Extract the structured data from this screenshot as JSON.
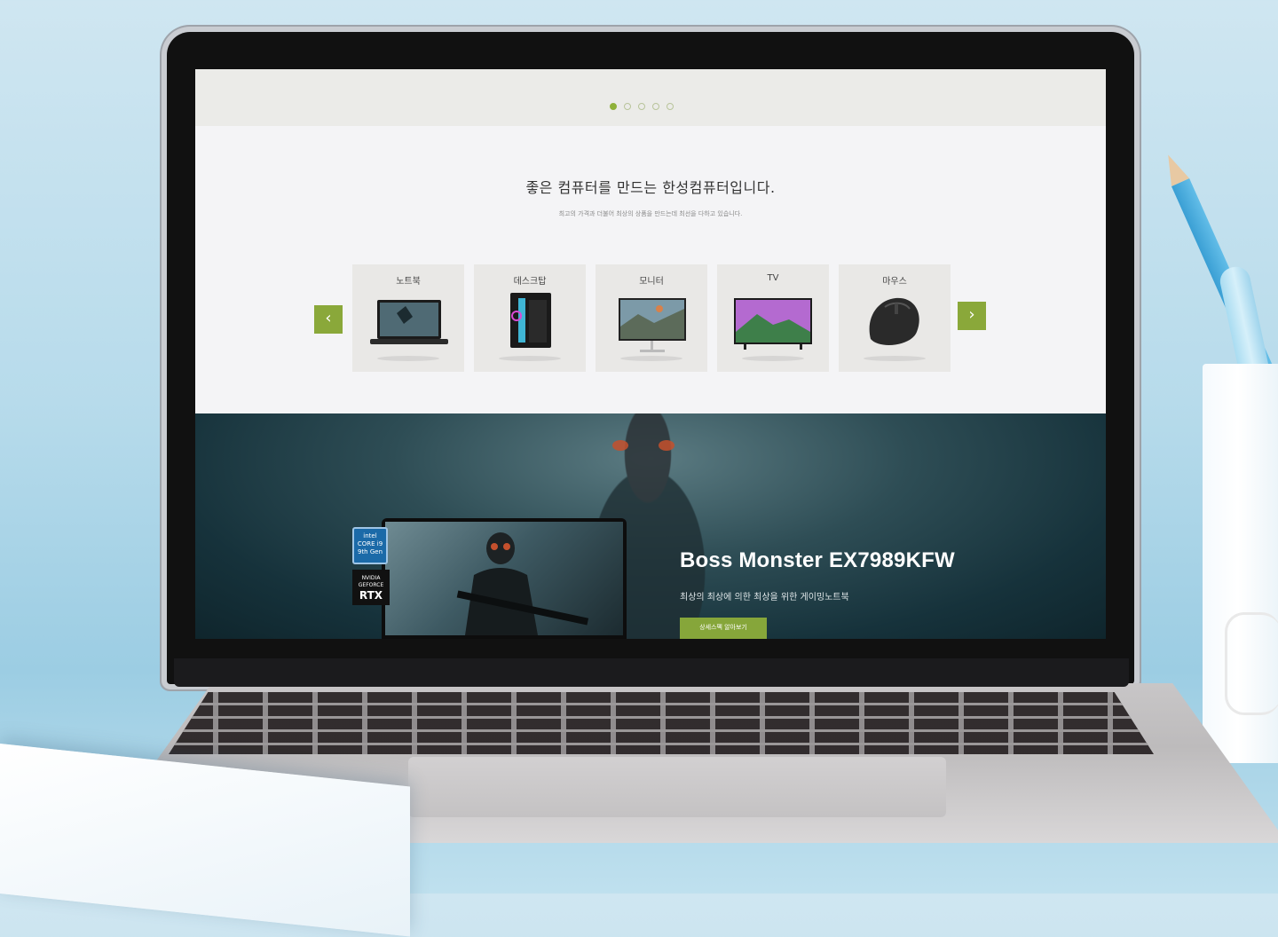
{
  "slider": {
    "dots": 5,
    "active_index": 0
  },
  "intro": {
    "headline": "좋은 컴퓨터를 만드는 한성컴퓨터입니다.",
    "subline": "최고의 가격과 더불어 최상의 상품을 만드는데 최선을 다하고 있습니다."
  },
  "categories": [
    {
      "label": "노트북"
    },
    {
      "label": "데스크탑"
    },
    {
      "label": "모니터"
    },
    {
      "label": "TV"
    },
    {
      "label": "마우스"
    }
  ],
  "nav": {
    "prev": "‹",
    "next": "›"
  },
  "hero": {
    "title": "Boss Monster EX7989KFW",
    "description": "최상의 최상에 의한 최상을 위한 게이밍노트북",
    "button": "상세스펙 알아보기",
    "badges": {
      "intel_line1": "intel",
      "intel_line2": "CORE i9",
      "intel_line3": "9th Gen",
      "rtx_line1": "NVIDIA GEFORCE",
      "rtx_line2": "RTX"
    }
  },
  "colors": {
    "accent": "#8aa83a",
    "hero_bg": "#2e4d55"
  }
}
